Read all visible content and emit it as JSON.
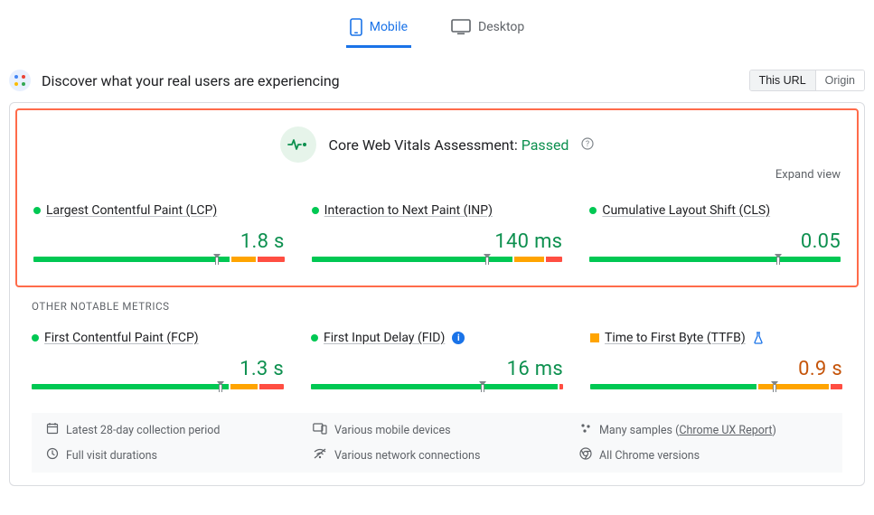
{
  "tabs": {
    "mobile": "Mobile",
    "desktop": "Desktop"
  },
  "header": {
    "title": "Discover what your real users are experiencing",
    "scope_this_url": "This URL",
    "scope_origin": "Origin"
  },
  "assessment": {
    "label": "Core Web Vitals Assessment:",
    "status": "Passed",
    "expand": "Expand view"
  },
  "core_metrics": [
    {
      "name": "Largest Contentful Paint (LCP)",
      "value": "1.8 s",
      "status": "green",
      "bar": {
        "g": 78,
        "o": 10,
        "r": 12
      },
      "marker": 73
    },
    {
      "name": "Interaction to Next Paint (INP)",
      "value": "140 ms",
      "status": "green",
      "bar": {
        "g": 80,
        "o": 12,
        "r": 8
      },
      "marker": 70
    },
    {
      "name": "Cumulative Layout Shift (CLS)",
      "value": "0.05",
      "status": "green",
      "bar": {
        "g": 100,
        "o": 0,
        "r": 0
      },
      "marker": 75
    }
  ],
  "other_label": "OTHER NOTABLE METRICS",
  "other_metrics": [
    {
      "name": "First Contentful Paint (FCP)",
      "value": "1.3 s",
      "status": "green",
      "badge": null,
      "bar": {
        "g": 78,
        "o": 11,
        "r": 11
      },
      "marker": 75
    },
    {
      "name": "First Input Delay (FID)",
      "value": "16 ms",
      "status": "green",
      "badge": "info",
      "bar": {
        "g": 98,
        "o": 0,
        "r": 2
      },
      "marker": 68
    },
    {
      "name": "Time to First Byte (TTFB)",
      "value": "0.9 s",
      "status": "orange",
      "badge": "flask",
      "bar": {
        "g": 66,
        "o": 28,
        "r": 6
      },
      "marker": 73
    }
  ],
  "footer": {
    "period": "Latest 28-day collection period",
    "devices": "Various mobile devices",
    "samples_prefix": "Many samples (",
    "samples_link": "Chrome UX Report",
    "samples_suffix": ")",
    "visit": "Full visit durations",
    "network": "Various network connections",
    "versions": "All Chrome versions"
  }
}
